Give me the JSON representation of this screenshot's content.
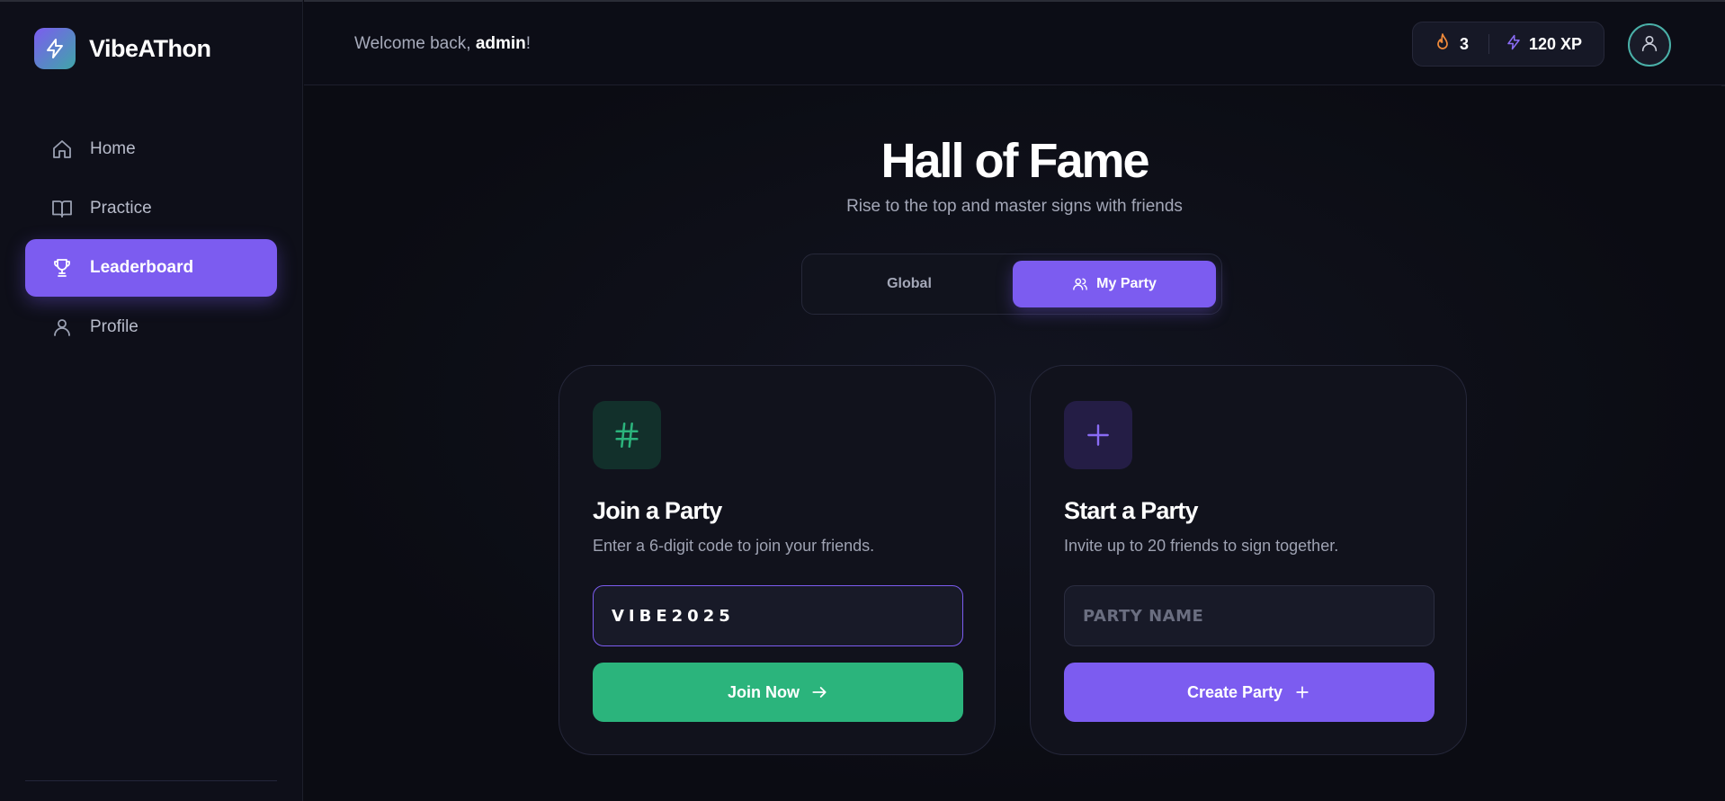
{
  "app": {
    "name": "VibeAThon",
    "logo_icon": "lightning-icon"
  },
  "sidebar": {
    "items": [
      {
        "label": "Home",
        "icon": "home-icon",
        "active": false
      },
      {
        "label": "Practice",
        "icon": "book-icon",
        "active": false
      },
      {
        "label": "Leaderboard",
        "icon": "trophy-icon",
        "active": true
      },
      {
        "label": "Profile",
        "icon": "user-icon",
        "active": false
      }
    ]
  },
  "header": {
    "welcome_prefix": "Welcome back, ",
    "username": "admin",
    "welcome_suffix": "!",
    "streak": "3",
    "streak_icon": "flame-icon",
    "xp": "120 XP",
    "xp_icon": "lightning-icon",
    "avatar_icon": "user-icon"
  },
  "main": {
    "title": "Hall of Fame",
    "subtitle": "Rise to the top and master signs with friends",
    "tabs": [
      {
        "label": "Global",
        "active": false
      },
      {
        "label": "My Party",
        "active": true,
        "icon": "users-icon"
      }
    ]
  },
  "join_card": {
    "icon": "hash-icon",
    "title": "Join a Party",
    "description": "Enter a 6-digit code to join your friends.",
    "code_value": "VIBE2025",
    "button_label": "Join Now",
    "button_icon": "arrow-right-icon"
  },
  "create_card": {
    "icon": "plus-icon",
    "title": "Start a Party",
    "description": "Invite up to 20 friends to sign together.",
    "name_placeholder": "PARTY NAME",
    "button_label": "Create Party",
    "button_icon": "plus-icon"
  },
  "colors": {
    "accent": "#7c5cf0",
    "success": "#2bb47c",
    "background": "#0b0c13",
    "card": "#11121c"
  }
}
